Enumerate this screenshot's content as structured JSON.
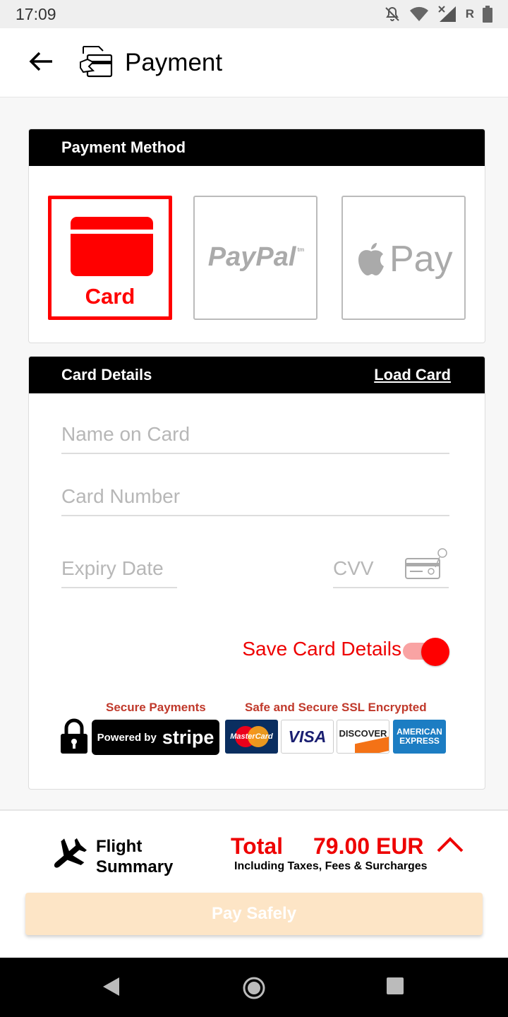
{
  "status_bar": {
    "time": "17:09",
    "carrier_letter": "R"
  },
  "header": {
    "title": "Payment"
  },
  "payment_method": {
    "heading": "Payment Method",
    "options": [
      {
        "id": "card",
        "label": "Card",
        "selected": true
      },
      {
        "id": "paypal",
        "label": "PayPal",
        "tm": "tm",
        "selected": false
      },
      {
        "id": "applepay",
        "label": "Pay",
        "selected": false
      }
    ]
  },
  "card_details": {
    "heading": "Card Details",
    "load_card": "Load Card",
    "name_placeholder": "Name on Card",
    "number_placeholder": "Card Number",
    "expiry_placeholder": "Expiry Date",
    "cvv_placeholder": "CVV",
    "save_label": "Save Card Details",
    "save_enabled": true
  },
  "trust": {
    "secure_payments": "Secure Payments",
    "ssl_label": "Safe and Secure SSL Encrypted",
    "stripe_powered": "Powered by",
    "stripe_word": "stripe",
    "brands": {
      "mastercard": "MasterCard",
      "visa": "VISA",
      "discover": "DISCOVER",
      "amex_line1": "AMERICAN",
      "amex_line2": "EXPRESS"
    }
  },
  "summary": {
    "flight_line1": "Flight",
    "flight_line2": "Summary",
    "total_label": "Total",
    "total_amount": "79.00 EUR",
    "total_sub": "Including Taxes, Fees & Surcharges",
    "pay_button": "Pay Safely"
  },
  "colors": {
    "accent": "#ff0000",
    "pay_button_disabled": "#fde5c6",
    "header_bg": "#000000"
  }
}
